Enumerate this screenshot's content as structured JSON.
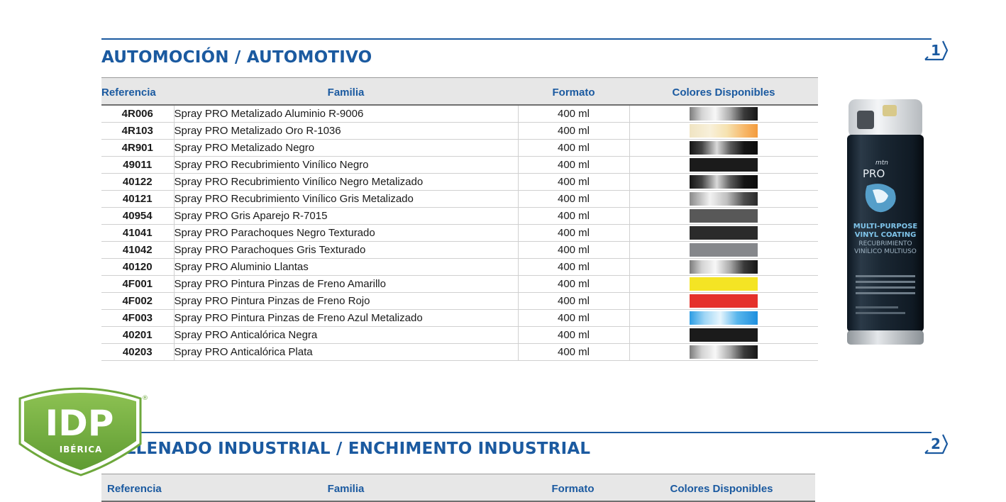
{
  "sections": [
    {
      "title": "AUTOMOCIÓN / AUTOMOTIVO",
      "number": "1",
      "headers": {
        "ref": "Referencia",
        "family": "Familia",
        "format": "Formato",
        "colors": "Colores Disponibles"
      },
      "rows": [
        {
          "ref": "4R006",
          "family": "Spray PRO Metalizado Aluminio R-9006",
          "format": "400 ml",
          "swatch": "silver"
        },
        {
          "ref": "4R103",
          "family": "Spray PRO Metalizado Oro R-1036",
          "format": "400 ml",
          "swatch": "gold"
        },
        {
          "ref": "4R901",
          "family": "Spray PRO Metalizado Negro",
          "format": "400 ml",
          "swatch": "black-metallic"
        },
        {
          "ref": "49011",
          "family": "Spray PRO Recubrimiento Vinílico Negro",
          "format": "400 ml",
          "swatch": "black"
        },
        {
          "ref": "40122",
          "family": "Spray PRO Recubrimiento Vinílico Negro Metalizado",
          "format": "400 ml",
          "swatch": "black-metallic"
        },
        {
          "ref": "40121",
          "family": "Spray PRO Recubrimiento Vinílico Gris Metalizado",
          "format": "400 ml",
          "swatch": "grey-metallic"
        },
        {
          "ref": "40954",
          "family": "Spray PRO Gris Aparejo R-7015",
          "format": "400 ml",
          "swatch": "slate"
        },
        {
          "ref": "41041",
          "family": "Spray PRO Parachoques Negro Texturado",
          "format": "400 ml",
          "swatch": "black-textured"
        },
        {
          "ref": "41042",
          "family": "Spray PRO Parachoques Gris Texturado",
          "format": "400 ml",
          "swatch": "grey"
        },
        {
          "ref": "40120",
          "family": "Spray PRO Aluminio Llantas",
          "format": "400 ml",
          "swatch": "silver"
        },
        {
          "ref": "4F001",
          "family": "Spray PRO Pintura Pinzas de Freno Amarillo",
          "format": "400 ml",
          "swatch": "yellow"
        },
        {
          "ref": "4F002",
          "family": "Spray PRO Pintura Pinzas de Freno Rojo",
          "format": "400 ml",
          "swatch": "red"
        },
        {
          "ref": "4F003",
          "family": "Spray PRO Pintura Pinzas de Freno Azul Metalizado",
          "format": "400 ml",
          "swatch": "blue-metallic"
        },
        {
          "ref": "40201",
          "family": "Spray PRO Anticalórica Negra",
          "format": "400 ml",
          "swatch": "black"
        },
        {
          "ref": "40203",
          "family": "Spray PRO Anticalórica Plata",
          "format": "400 ml",
          "swatch": "silver"
        }
      ]
    },
    {
      "title": "RELLENADO INDUSTRIAL / ENCHIMENTO INDUSTRIAL",
      "number": "2",
      "headers": {
        "ref": "Referencia",
        "family": "Familia",
        "format": "Formato",
        "colors": "Colores Disponibles"
      },
      "rows": []
    }
  ],
  "swatches": {
    "silver": "linear-gradient(90deg,#7c7c7c 0%,#d4d4d4 18%,#f7f7f7 38%,#a7a7a7 60%,#3a3a3a 80%,#161616 100%)",
    "gold": "linear-gradient(90deg,#f0e4c2 0%,#f8f0da 30%,#f6e2b0 55%,#f7b86a 80%,#f39b3c 100%)",
    "black-metallic": "linear-gradient(90deg,#151515 0%,#444444 18%,#d9d9d9 40%,#5a5a5a 60%,#151515 80%,#0c0c0c 100%)",
    "black": "#1b1b1b",
    "grey-metallic": "linear-gradient(90deg,#8a8a8a 0%,#f2f2f2 30%,#bfbfbf 55%,#4d4d4d 80%,#2a2a2a 100%)",
    "slate": "#585858",
    "black-textured": "#2b2b2b",
    "grey": "#85878b",
    "yellow": "#f4e424",
    "red": "#e5312b",
    "blue-metallic": "linear-gradient(90deg,#2a9ce4 0%,#9fd6f5 22%,#e6f5fd 45%,#59b6ec 70%,#1e8fde 100%)"
  },
  "product_image": {
    "brand": "mtn",
    "line": "PRO",
    "label_1": "MULTI-PURPOSE",
    "label_2": "VINYL COATING",
    "label_3": "RECUBRIMIENTO",
    "label_4": "VINÍLICO MULTIUSO"
  },
  "logo": {
    "name": "IDP",
    "sub": "IBÉRICA",
    "reg": "®"
  },
  "colors": {
    "accent": "#1b5aa0",
    "header_bg": "#e7e7e7",
    "logo_green": "#7cb342"
  }
}
